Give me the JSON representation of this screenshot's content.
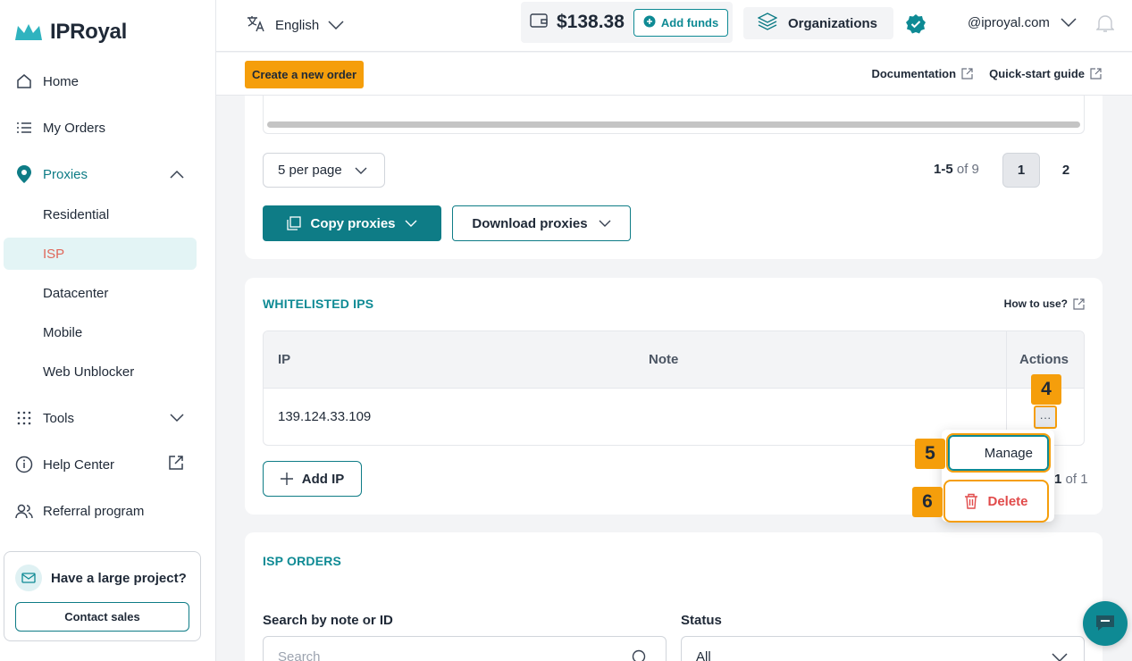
{
  "brand": {
    "name": "IPRoyal",
    "accent": "#0e8a94",
    "highlight": "#f59e0b"
  },
  "sidebar": {
    "items": [
      {
        "label": "Home",
        "icon": "home-icon"
      },
      {
        "label": "My Orders",
        "icon": "list-icon"
      },
      {
        "label": "Proxies",
        "icon": "location-pin-icon"
      },
      {
        "label": "Tools",
        "icon": "grid-dots-icon"
      },
      {
        "label": "Help Center",
        "icon": "help-circle-icon"
      },
      {
        "label": "Referral program",
        "icon": "users-icon"
      }
    ],
    "proxies_sub": [
      "Residential",
      "ISP",
      "Datacenter",
      "Mobile",
      "Web Unblocker"
    ],
    "active_sub": "ISP",
    "promo": {
      "title": "Have a large project?",
      "button": "Contact sales"
    }
  },
  "topbar": {
    "language": "English",
    "balance": "$138.38",
    "add_funds": "Add funds",
    "organizations": "Organizations",
    "email": "@iproyal.com"
  },
  "subbar": {
    "create_order": "Create a new order",
    "documentation": "Documentation",
    "quickstart": "Quick-start guide"
  },
  "proxy_list": {
    "per_page": "5 per page",
    "range": "1-5",
    "of_text": "of 9",
    "pages": [
      "1",
      "2"
    ],
    "copy": "Copy proxies",
    "download": "Download proxies"
  },
  "whitelist": {
    "title": "WHITELISTED IPS",
    "how_to": "How to use?",
    "columns": [
      "IP",
      "Note",
      "Actions"
    ],
    "rows": [
      {
        "ip": "139.124.33.109",
        "note": ""
      }
    ],
    "add_ip": "Add IP",
    "page_num": "1",
    "page_of": "of 1",
    "menu": {
      "manage": "Manage",
      "delete": "Delete"
    }
  },
  "isp_orders": {
    "title": "ISP ORDERS",
    "search_label": "Search by note or ID",
    "search_placeholder": "Search",
    "status_label": "Status",
    "status_value": "All"
  },
  "annotations": [
    "4",
    "5",
    "6"
  ]
}
